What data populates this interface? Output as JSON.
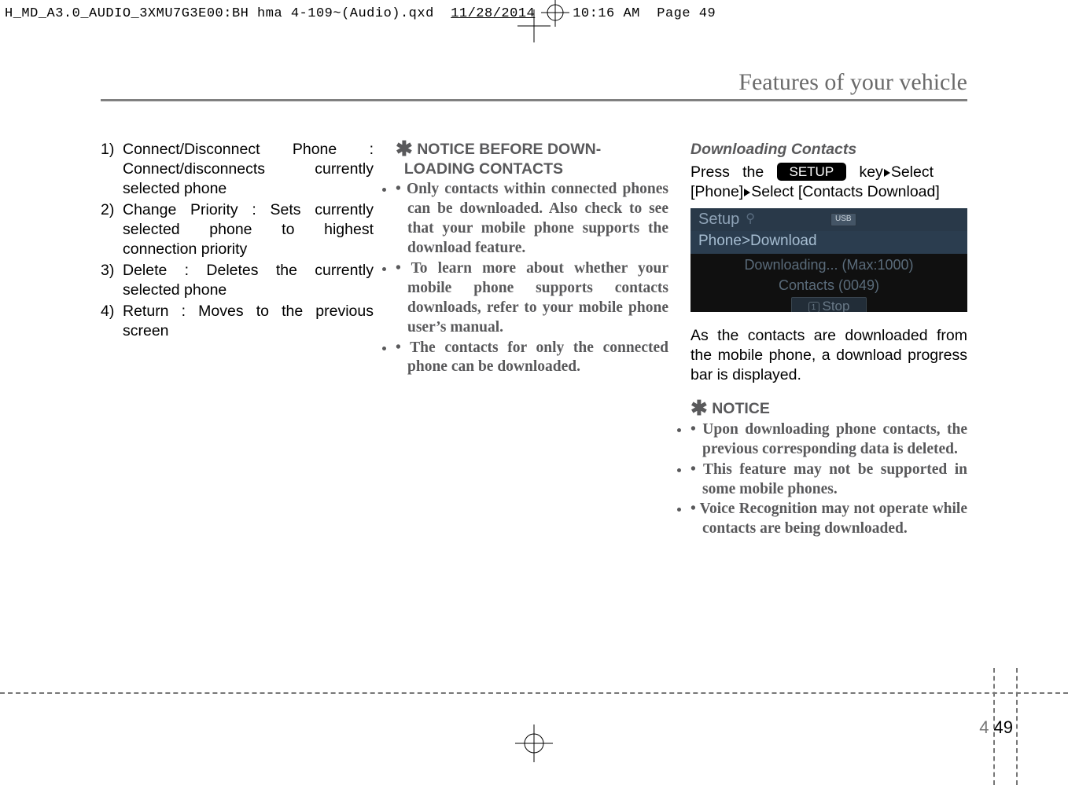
{
  "header": {
    "filename_a": "H_MD_A3.0_AUDIO_3XMU7G3E00:BH hma 4-109~(Audio).qxd",
    "date": "11/28/20",
    "date_overstrike": "14",
    "time": "10:16 AM",
    "page_label": "Page 49"
  },
  "chapter_title": "Features of your vehicle",
  "col1": {
    "items": [
      {
        "n": "1)",
        "t": "Connect/Disconnect Phone : Connect/disconnects currently selected phone"
      },
      {
        "n": "2)",
        "t": "Change Priority : Sets currently selected phone to highest connection priority"
      },
      {
        "n": "3)",
        "t": "Delete : Deletes the currently selected phone"
      },
      {
        "n": "4)",
        "t": "Return : Moves to the previous screen"
      }
    ]
  },
  "col2": {
    "notice_star": "✱",
    "notice_title_l1": "NOTICE BEFORE DOWN-",
    "notice_title_l2": "LOADING CONTACTS",
    "bullets": [
      "Only contacts within connected phones can be downloaded. Also check to see that your mobile phone supports the download feature.",
      "To learn more about whether your mobile phone supports contacts downloads, refer to your mobile phone user’s manual.",
      "The contacts for only the connected phone can be downloaded."
    ]
  },
  "col3": {
    "subhead": "Downloading Contacts",
    "press_word": "Press",
    "the_word": "the",
    "setup_key": "SETUP",
    "key_word": "key",
    "select_word": "Select",
    "line2_a": "[Phone]",
    "line2_b": "Select [Contacts Download]",
    "screen": {
      "title": "Setup",
      "bt_glyph": "⚲",
      "usb": "USB",
      "breadcrumb": "Phone>Download",
      "dl1": "Downloading... (Max:1000)",
      "dl2": "Contacts (0049)",
      "stop_num": "1",
      "stop": "Stop"
    },
    "para": "As the contacts are downloaded from the mobile phone, a download progress bar is displayed.",
    "notice2_star": "✱",
    "notice2_title": "NOTICE",
    "bullets": [
      "Upon downloading phone contacts, the previous corresponding data is deleted.",
      "This feature may not be supported in some mobile phones.",
      "Voice Recognition may not operate while contacts are being downloaded."
    ]
  },
  "page_chapter": "4",
  "page_number": "49"
}
